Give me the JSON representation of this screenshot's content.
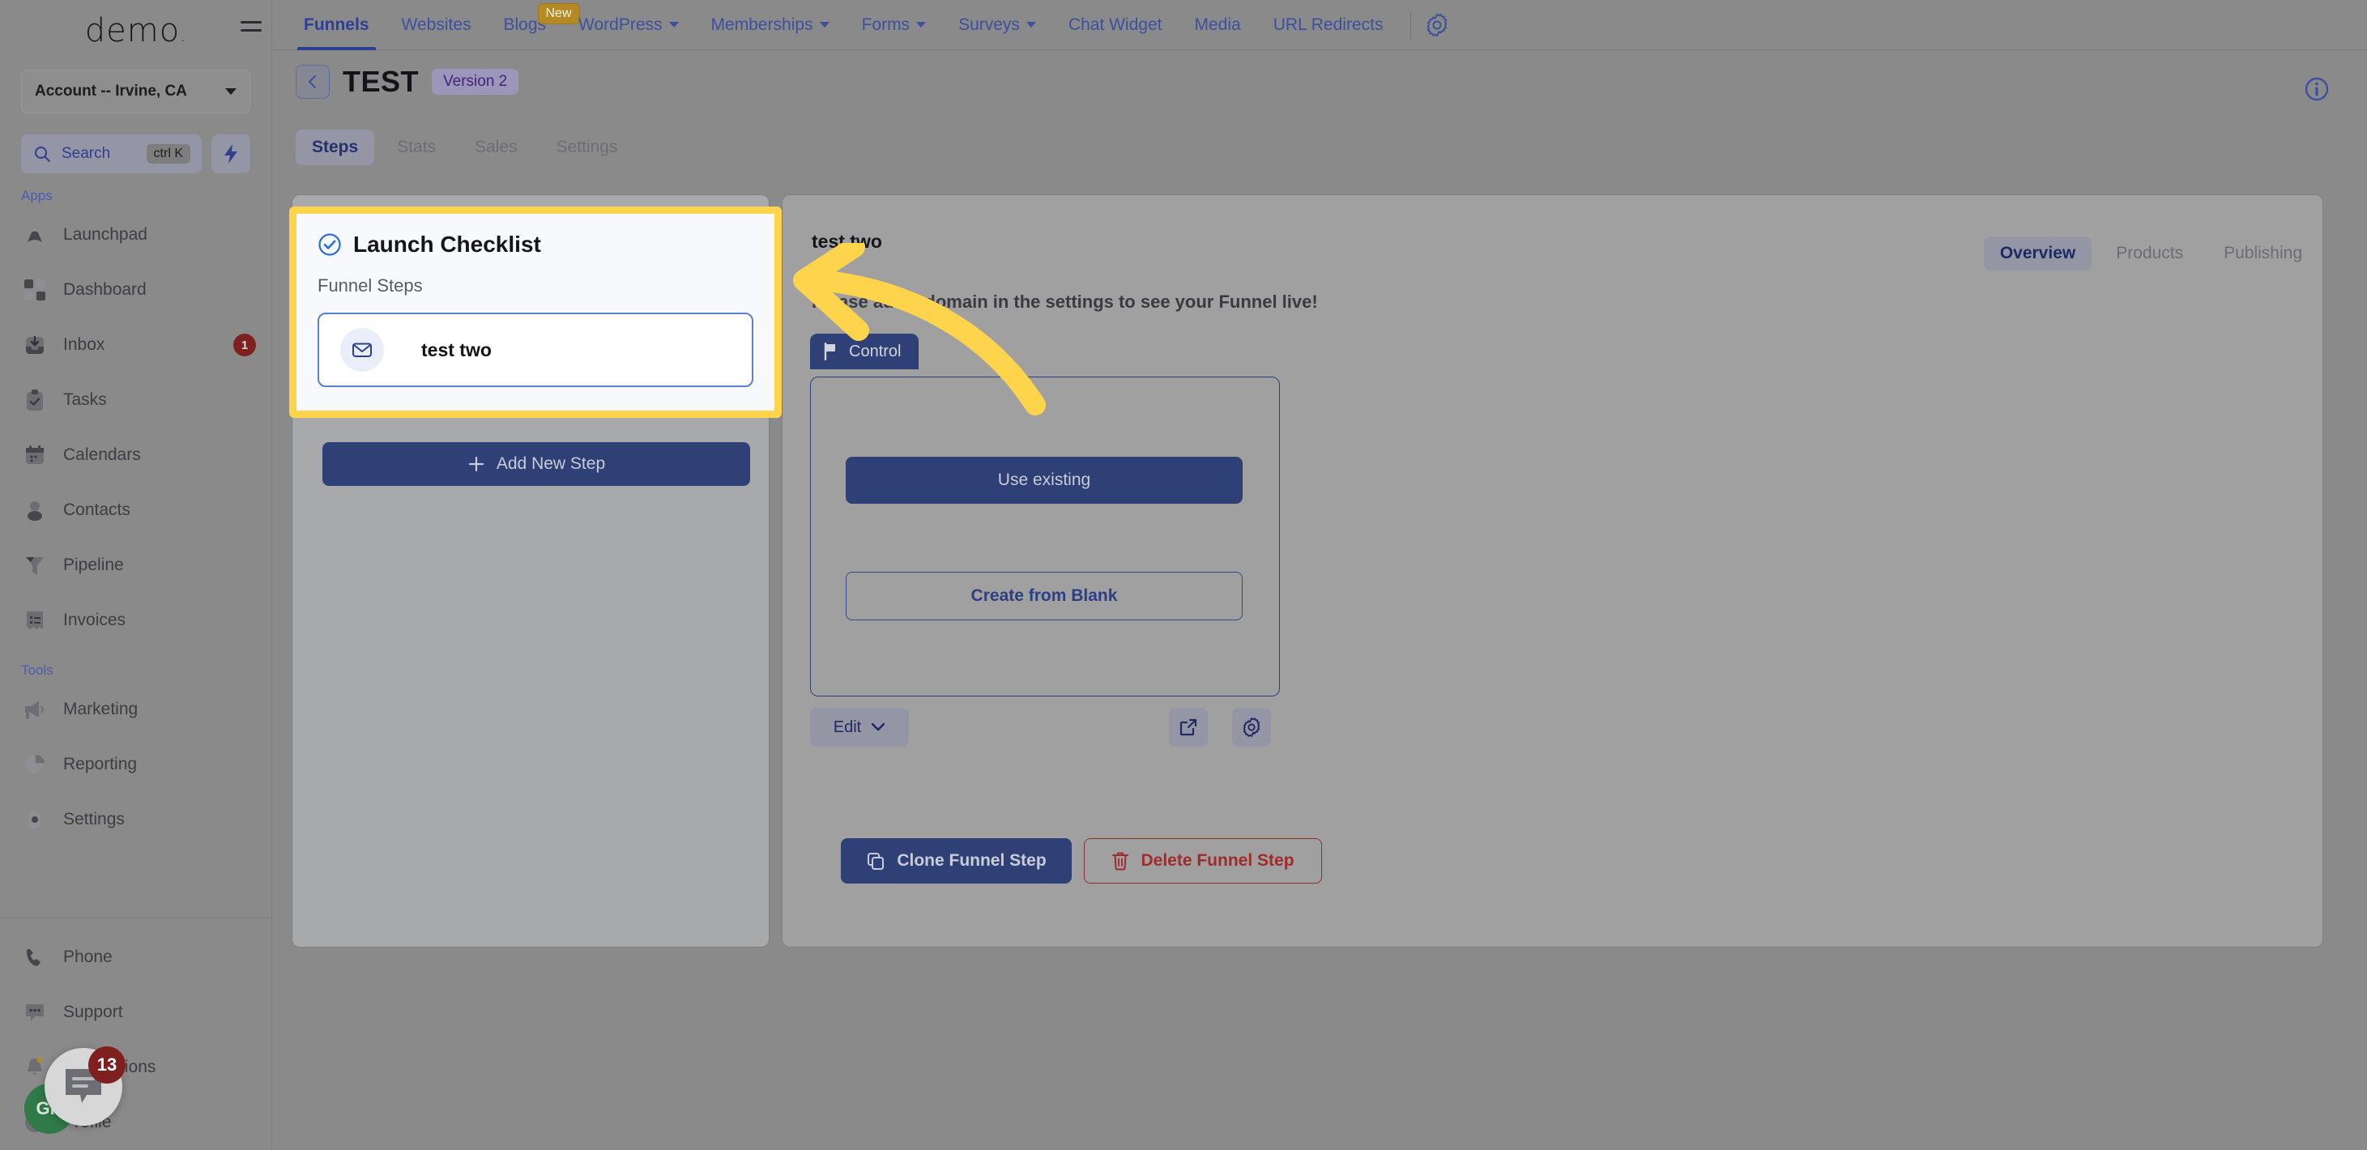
{
  "sidebar": {
    "brand": "demo",
    "account_selector": "Account -- Irvine, CA",
    "search": {
      "label": "Search",
      "shortcut": "ctrl K"
    },
    "sections": [
      {
        "label": "Apps",
        "items": [
          {
            "label": "Launchpad",
            "icon": "rocket-icon",
            "badge": ""
          },
          {
            "label": "Dashboard",
            "icon": "grid-icon",
            "badge": ""
          },
          {
            "label": "Inbox",
            "icon": "inbox-icon",
            "badge": "1"
          },
          {
            "label": "Tasks",
            "icon": "clipboard-check-icon",
            "badge": ""
          },
          {
            "label": "Calendars",
            "icon": "calendar-icon",
            "badge": ""
          },
          {
            "label": "Contacts",
            "icon": "person-icon",
            "badge": ""
          },
          {
            "label": "Pipeline",
            "icon": "funnel-icon",
            "badge": ""
          },
          {
            "label": "Invoices",
            "icon": "invoice-icon",
            "badge": ""
          }
        ]
      },
      {
        "label": "Tools",
        "items": [
          {
            "label": "Marketing",
            "icon": "megaphone-icon",
            "badge": ""
          },
          {
            "label": "Reporting",
            "icon": "pie-chart-icon",
            "badge": ""
          },
          {
            "label": "Settings",
            "icon": "gear-icon",
            "badge": ""
          }
        ]
      }
    ],
    "bottom_items": [
      {
        "label": "Phone",
        "icon": "phone-icon"
      },
      {
        "label": "Support",
        "icon": "chat-dots-icon"
      },
      {
        "label": "Notifications",
        "icon": "bell-icon"
      },
      {
        "label": "Profile",
        "icon": "avatar-icon"
      }
    ],
    "chat_widget_badge": "13",
    "avatar_initials": "GR"
  },
  "topnav": {
    "items": [
      {
        "label": "Funnels",
        "active": true,
        "caret": false,
        "pill": ""
      },
      {
        "label": "Websites",
        "active": false,
        "caret": false,
        "pill": ""
      },
      {
        "label": "Blogs",
        "active": false,
        "caret": false,
        "pill": "New"
      },
      {
        "label": "WordPress",
        "active": false,
        "caret": true,
        "pill": ""
      },
      {
        "label": "Memberships",
        "active": false,
        "caret": true,
        "pill": ""
      },
      {
        "label": "Forms",
        "active": false,
        "caret": true,
        "pill": ""
      },
      {
        "label": "Surveys",
        "active": false,
        "caret": true,
        "pill": ""
      },
      {
        "label": "Chat Widget",
        "active": false,
        "caret": false,
        "pill": ""
      },
      {
        "label": "Media",
        "active": false,
        "caret": false,
        "pill": ""
      },
      {
        "label": "URL Redirects",
        "active": false,
        "caret": false,
        "pill": ""
      }
    ],
    "settings_icon": "gear-icon"
  },
  "header": {
    "back_icon": "chevron-left-icon",
    "title": "TEST",
    "version_badge": "Version 2",
    "info_icon": "info-circle-icon"
  },
  "subtabs": [
    {
      "label": "Steps",
      "active": true
    },
    {
      "label": "Stats",
      "active": false
    },
    {
      "label": "Sales",
      "active": false
    },
    {
      "label": "Settings",
      "active": false
    }
  ],
  "launch_checklist": {
    "title": "Launch Checklist",
    "check_icon": "check-circle-icon",
    "section_label": "Funnel Steps",
    "steps": [
      {
        "name": "test two",
        "icon": "envelope-icon"
      }
    ],
    "highlight_color": "#ffd44d"
  },
  "add_new_step": {
    "label": "Add New Step",
    "icon": "plus-icon"
  },
  "detail": {
    "title": "test two",
    "notice": "Please add a domain in the settings to see your Funnel live!",
    "tabs": [
      {
        "label": "Overview",
        "active": true
      },
      {
        "label": "Products",
        "active": false
      },
      {
        "label": "Publishing",
        "active": false
      }
    ],
    "variant_tab": {
      "label": "Control",
      "icon": "flag-icon"
    },
    "use_existing_label": "Use existing",
    "create_from_blank_label": "Create from Blank",
    "edit_label": "Edit",
    "edit_caret_icon": "chevron-down-icon",
    "external_link_icon": "external-link-icon",
    "settings_icon": "gear-icon",
    "clone_button": {
      "label": "Clone Funnel Step",
      "icon": "copy-icon"
    },
    "delete_button": {
      "label": "Delete Funnel Step",
      "icon": "trash-icon"
    }
  },
  "colors": {
    "primary": "#2e4075",
    "highlight_yellow": "#ffd44d",
    "danger": "#a02b2b",
    "accent_link": "#3d4f9e"
  }
}
